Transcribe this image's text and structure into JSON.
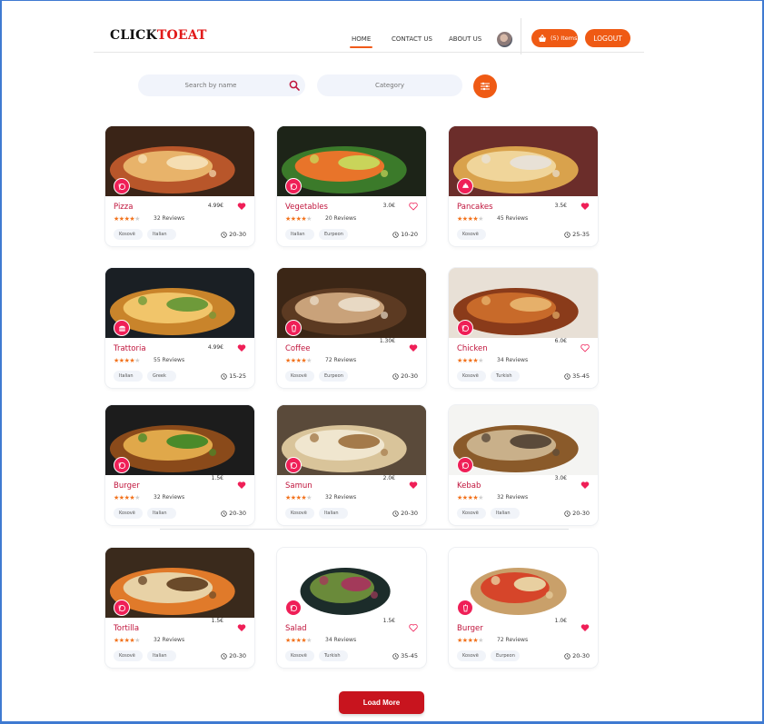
{
  "brand": {
    "part1": "CLICK",
    "part2": "TOEAT"
  },
  "nav": {
    "items": [
      {
        "label": "HOME",
        "active": true
      },
      {
        "label": "CONTACT US",
        "active": false
      },
      {
        "label": "ABOUT US",
        "active": false
      }
    ],
    "cart_label": "(5) Items",
    "logout_label": "LOGOUT"
  },
  "search": {
    "placeholder": "Search by name",
    "category_placeholder": "Category"
  },
  "colors": {
    "accent": "#ef5a14",
    "badge": "#ef1f57",
    "heart": "#ef1f57",
    "star": "#f2721c",
    "title": "#c0143c",
    "load_more": "#c8141e"
  },
  "cards": [
    {
      "name": "Pizza",
      "price": "4.99€",
      "rating": 4,
      "reviews": "32 Reviews",
      "tags": [
        "Kosovë",
        "Italian"
      ],
      "time": "20-30",
      "liked": true,
      "icon": "food-icon"
    },
    {
      "name": "Vegetables",
      "price": "3.0€",
      "rating": 4,
      "reviews": "20 Reviews",
      "tags": [
        "Italian",
        "Eurpeon"
      ],
      "time": "10-20",
      "liked": false,
      "icon": "food-icon"
    },
    {
      "name": "Pancakes",
      "price": "3.5€",
      "rating": 4,
      "reviews": "45 Reviews",
      "tags": [
        "Kosovë"
      ],
      "time": "25-35",
      "liked": true,
      "icon": "dessert-icon"
    },
    {
      "name": "Trattoria",
      "price": "4.99€",
      "rating": 4,
      "reviews": "55 Reviews",
      "tags": [
        "Italian",
        "Greek"
      ],
      "time": "15-25",
      "liked": true,
      "icon": "burger-icon"
    },
    {
      "name": "Coffee",
      "price": "1.30€",
      "rating": 4,
      "reviews": "72 Reviews",
      "tags": [
        "Kosovë",
        "Eurpeon"
      ],
      "time": "20-30",
      "liked": true,
      "icon": "drink-icon"
    },
    {
      "name": "Chicken",
      "price": "6.0€",
      "rating": 4,
      "reviews": "34 Reviews",
      "tags": [
        "Kosovë",
        "Turkish"
      ],
      "time": "35-45",
      "liked": false,
      "icon": "food-icon"
    },
    {
      "name": "Burger",
      "price": "1.5€",
      "rating": 4,
      "reviews": "32 Reviews",
      "tags": [
        "Kosovë",
        "Italian"
      ],
      "time": "20-30",
      "liked": true,
      "icon": "food-icon"
    },
    {
      "name": "Samun",
      "price": "2.0€",
      "rating": 4,
      "reviews": "32 Reviews",
      "tags": [
        "Kosovë",
        "Italian"
      ],
      "time": "20-30",
      "liked": true,
      "icon": "food-icon"
    },
    {
      "name": "Kebab",
      "price": "3.0€",
      "rating": 4,
      "reviews": "32 Reviews",
      "tags": [
        "Kosovë",
        "Italian"
      ],
      "time": "20-30",
      "liked": true,
      "icon": "food-icon"
    },
    {
      "name": "Tortilla",
      "price": "1.5€",
      "rating": 4,
      "reviews": "32 Reviews",
      "tags": [
        "Kosovë",
        "Italian"
      ],
      "time": "20-30",
      "liked": true,
      "icon": "food-icon"
    },
    {
      "name": "Salad",
      "price": "1.5€",
      "rating": 4,
      "reviews": "34 Reviews",
      "tags": [
        "Kosovë",
        "Turkish"
      ],
      "time": "35-45",
      "liked": false,
      "icon": "food-icon"
    },
    {
      "name": "Burger",
      "price": "1.0€",
      "rating": 4,
      "reviews": "72 Reviews",
      "tags": [
        "Kosovë",
        "Eurpeon"
      ],
      "time": "20-30",
      "liked": true,
      "icon": "drink-icon"
    }
  ],
  "load_more_label": "Load More"
}
